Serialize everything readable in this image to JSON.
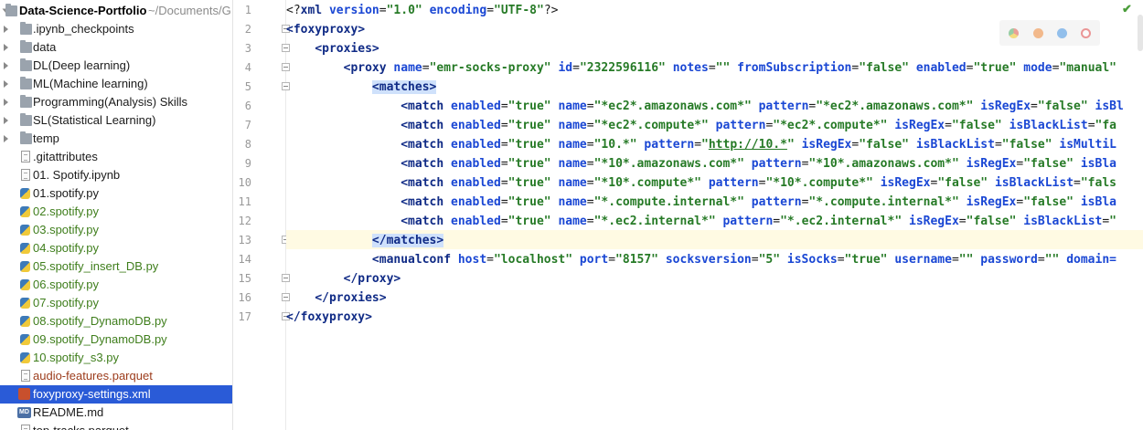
{
  "project_tree": {
    "root": {
      "name": "Data-Science-Portfolio",
      "path": "~/Documents/G"
    },
    "items": [
      {
        "label": ".ipynb_checkpoints",
        "kind": "folder",
        "color": "default"
      },
      {
        "label": "data",
        "kind": "folder",
        "color": "default"
      },
      {
        "label": "DL(Deep learning)",
        "kind": "folder",
        "color": "default"
      },
      {
        "label": "ML(Machine learning)",
        "kind": "folder",
        "color": "default"
      },
      {
        "label": "Programming(Analysis) Skills",
        "kind": "folder",
        "color": "default"
      },
      {
        "label": "SL(Statistical Learning)",
        "kind": "folder",
        "color": "default"
      },
      {
        "label": "temp",
        "kind": "folder",
        "color": "default"
      },
      {
        "label": ".gitattributes",
        "kind": "text-file",
        "color": "default"
      },
      {
        "label": "01. Spotify.ipynb",
        "kind": "text-file",
        "color": "default"
      },
      {
        "label": "01.spotify.py",
        "kind": "python-file",
        "color": "default"
      },
      {
        "label": "02.spotify.py",
        "kind": "python-file",
        "color": "green"
      },
      {
        "label": "03.spotify.py",
        "kind": "python-file",
        "color": "green"
      },
      {
        "label": "04.spotify.py",
        "kind": "python-file",
        "color": "green"
      },
      {
        "label": "05.spotify_insert_DB.py",
        "kind": "python-file",
        "color": "green"
      },
      {
        "label": "06.spotify.py",
        "kind": "python-file",
        "color": "green"
      },
      {
        "label": "07.spotify.py",
        "kind": "python-file",
        "color": "green"
      },
      {
        "label": "08.spotify_DynamoDB.py",
        "kind": "python-file",
        "color": "green"
      },
      {
        "label": "09.spotify_DynamoDB.py",
        "kind": "python-file",
        "color": "green"
      },
      {
        "label": "10.spotify_s3.py",
        "kind": "python-file",
        "color": "green"
      },
      {
        "label": "audio-features.parquet",
        "kind": "text-file",
        "color": "brown"
      },
      {
        "label": "foxyproxy-settings.xml",
        "kind": "xml-file",
        "color": "default",
        "selected": true
      },
      {
        "label": "README.md",
        "kind": "md-file",
        "color": "default"
      },
      {
        "label": "top-tracks.parquet",
        "kind": "text-file",
        "color": "default"
      }
    ]
  },
  "editor": {
    "line_numbers": [
      "1",
      "2",
      "3",
      "4",
      "5",
      "6",
      "7",
      "8",
      "9",
      "10",
      "11",
      "12",
      "13",
      "14",
      "15",
      "16",
      "17"
    ],
    "lines": [
      [
        {
          "t": "pi",
          "v": "<?"
        },
        {
          "t": "tag",
          "v": "xml "
        },
        {
          "t": "attr",
          "v": "version"
        },
        {
          "t": "plain",
          "v": "="
        },
        {
          "t": "val",
          "v": "\"1.0\" "
        },
        {
          "t": "attr",
          "v": "encoding"
        },
        {
          "t": "plain",
          "v": "="
        },
        {
          "t": "val",
          "v": "\"UTF-8\""
        },
        {
          "t": "pi",
          "v": "?>"
        }
      ],
      [
        {
          "t": "tag",
          "v": "<foxyproxy>"
        }
      ],
      [
        {
          "t": "plain",
          "v": "    "
        },
        {
          "t": "tag",
          "v": "<proxies>"
        }
      ],
      [
        {
          "t": "plain",
          "v": "        "
        },
        {
          "t": "tag",
          "v": "<proxy "
        },
        {
          "t": "attr",
          "v": "name"
        },
        {
          "t": "plain",
          "v": "="
        },
        {
          "t": "val",
          "v": "\"emr-socks-proxy\" "
        },
        {
          "t": "attr",
          "v": "id"
        },
        {
          "t": "plain",
          "v": "="
        },
        {
          "t": "val",
          "v": "\"2322596116\" "
        },
        {
          "t": "attr",
          "v": "notes"
        },
        {
          "t": "plain",
          "v": "="
        },
        {
          "t": "val",
          "v": "\"\" "
        },
        {
          "t": "attr",
          "v": "fromSubscription"
        },
        {
          "t": "plain",
          "v": "="
        },
        {
          "t": "val",
          "v": "\"false\" "
        },
        {
          "t": "attr",
          "v": "enabled"
        },
        {
          "t": "plain",
          "v": "="
        },
        {
          "t": "val",
          "v": "\"true\" "
        },
        {
          "t": "attr",
          "v": "mode"
        },
        {
          "t": "plain",
          "v": "="
        },
        {
          "t": "val",
          "v": "\"manual\""
        }
      ],
      [
        {
          "t": "plain",
          "v": "            "
        },
        {
          "t": "taghl",
          "v": "<matches>"
        }
      ],
      [
        {
          "t": "plain",
          "v": "                "
        },
        {
          "t": "tag",
          "v": "<match "
        },
        {
          "t": "attr",
          "v": "enabled"
        },
        {
          "t": "plain",
          "v": "="
        },
        {
          "t": "val",
          "v": "\"true\" "
        },
        {
          "t": "attr",
          "v": "name"
        },
        {
          "t": "plain",
          "v": "="
        },
        {
          "t": "val",
          "v": "\"*ec2*.amazonaws.com*\" "
        },
        {
          "t": "attr",
          "v": "pattern"
        },
        {
          "t": "plain",
          "v": "="
        },
        {
          "t": "val",
          "v": "\"*ec2*.amazonaws.com*\" "
        },
        {
          "t": "attr",
          "v": "isRegEx"
        },
        {
          "t": "plain",
          "v": "="
        },
        {
          "t": "val",
          "v": "\"false\" "
        },
        {
          "t": "attr",
          "v": "isBl"
        }
      ],
      [
        {
          "t": "plain",
          "v": "                "
        },
        {
          "t": "tag",
          "v": "<match "
        },
        {
          "t": "attr",
          "v": "enabled"
        },
        {
          "t": "plain",
          "v": "="
        },
        {
          "t": "val",
          "v": "\"true\" "
        },
        {
          "t": "attr",
          "v": "name"
        },
        {
          "t": "plain",
          "v": "="
        },
        {
          "t": "val",
          "v": "\"*ec2*.compute*\" "
        },
        {
          "t": "attr",
          "v": "pattern"
        },
        {
          "t": "plain",
          "v": "="
        },
        {
          "t": "val",
          "v": "\"*ec2*.compute*\" "
        },
        {
          "t": "attr",
          "v": "isRegEx"
        },
        {
          "t": "plain",
          "v": "="
        },
        {
          "t": "val",
          "v": "\"false\" "
        },
        {
          "t": "attr",
          "v": "isBlackList"
        },
        {
          "t": "plain",
          "v": "="
        },
        {
          "t": "val",
          "v": "\"fa"
        }
      ],
      [
        {
          "t": "plain",
          "v": "                "
        },
        {
          "t": "tag",
          "v": "<match "
        },
        {
          "t": "attr",
          "v": "enabled"
        },
        {
          "t": "plain",
          "v": "="
        },
        {
          "t": "val",
          "v": "\"true\" "
        },
        {
          "t": "attr",
          "v": "name"
        },
        {
          "t": "plain",
          "v": "="
        },
        {
          "t": "val",
          "v": "\"10.*\" "
        },
        {
          "t": "attr",
          "v": "pattern"
        },
        {
          "t": "plain",
          "v": "="
        },
        {
          "t": "val",
          "v": "\""
        },
        {
          "t": "url",
          "v": "http://10.*"
        },
        {
          "t": "val",
          "v": "\" "
        },
        {
          "t": "attr",
          "v": "isRegEx"
        },
        {
          "t": "plain",
          "v": "="
        },
        {
          "t": "val",
          "v": "\"false\" "
        },
        {
          "t": "attr",
          "v": "isBlackList"
        },
        {
          "t": "plain",
          "v": "="
        },
        {
          "t": "val",
          "v": "\"false\" "
        },
        {
          "t": "attr",
          "v": "isMultiL"
        }
      ],
      [
        {
          "t": "plain",
          "v": "                "
        },
        {
          "t": "tag",
          "v": "<match "
        },
        {
          "t": "attr",
          "v": "enabled"
        },
        {
          "t": "plain",
          "v": "="
        },
        {
          "t": "val",
          "v": "\"true\" "
        },
        {
          "t": "attr",
          "v": "name"
        },
        {
          "t": "plain",
          "v": "="
        },
        {
          "t": "val",
          "v": "\"*10*.amazonaws.com*\" "
        },
        {
          "t": "attr",
          "v": "pattern"
        },
        {
          "t": "plain",
          "v": "="
        },
        {
          "t": "val",
          "v": "\"*10*.amazonaws.com*\" "
        },
        {
          "t": "attr",
          "v": "isRegEx"
        },
        {
          "t": "plain",
          "v": "="
        },
        {
          "t": "val",
          "v": "\"false\" "
        },
        {
          "t": "attr",
          "v": "isBla"
        }
      ],
      [
        {
          "t": "plain",
          "v": "                "
        },
        {
          "t": "tag",
          "v": "<match "
        },
        {
          "t": "attr",
          "v": "enabled"
        },
        {
          "t": "plain",
          "v": "="
        },
        {
          "t": "val",
          "v": "\"true\" "
        },
        {
          "t": "attr",
          "v": "name"
        },
        {
          "t": "plain",
          "v": "="
        },
        {
          "t": "val",
          "v": "\"*10*.compute*\" "
        },
        {
          "t": "attr",
          "v": "pattern"
        },
        {
          "t": "plain",
          "v": "="
        },
        {
          "t": "val",
          "v": "\"*10*.compute*\" "
        },
        {
          "t": "attr",
          "v": "isRegEx"
        },
        {
          "t": "plain",
          "v": "="
        },
        {
          "t": "val",
          "v": "\"false\" "
        },
        {
          "t": "attr",
          "v": "isBlackList"
        },
        {
          "t": "plain",
          "v": "="
        },
        {
          "t": "val",
          "v": "\"fals"
        }
      ],
      [
        {
          "t": "plain",
          "v": "                "
        },
        {
          "t": "tag",
          "v": "<match "
        },
        {
          "t": "attr",
          "v": "enabled"
        },
        {
          "t": "plain",
          "v": "="
        },
        {
          "t": "val",
          "v": "\"true\" "
        },
        {
          "t": "attr",
          "v": "name"
        },
        {
          "t": "plain",
          "v": "="
        },
        {
          "t": "val",
          "v": "\"*.compute.internal*\" "
        },
        {
          "t": "attr",
          "v": "pattern"
        },
        {
          "t": "plain",
          "v": "="
        },
        {
          "t": "val",
          "v": "\"*.compute.internal*\" "
        },
        {
          "t": "attr",
          "v": "isRegEx"
        },
        {
          "t": "plain",
          "v": "="
        },
        {
          "t": "val",
          "v": "\"false\" "
        },
        {
          "t": "attr",
          "v": "isBla"
        }
      ],
      [
        {
          "t": "plain",
          "v": "                "
        },
        {
          "t": "tag",
          "v": "<match "
        },
        {
          "t": "attr",
          "v": "enabled"
        },
        {
          "t": "plain",
          "v": "="
        },
        {
          "t": "val",
          "v": "\"true\" "
        },
        {
          "t": "attr",
          "v": "name"
        },
        {
          "t": "plain",
          "v": "="
        },
        {
          "t": "val",
          "v": "\"*.ec2.internal*\" "
        },
        {
          "t": "attr",
          "v": "pattern"
        },
        {
          "t": "plain",
          "v": "="
        },
        {
          "t": "val",
          "v": "\"*.ec2.internal*\" "
        },
        {
          "t": "attr",
          "v": "isRegEx"
        },
        {
          "t": "plain",
          "v": "="
        },
        {
          "t": "val",
          "v": "\"false\" "
        },
        {
          "t": "attr",
          "v": "isBlackList"
        },
        {
          "t": "plain",
          "v": "="
        },
        {
          "t": "val",
          "v": "\""
        }
      ],
      [
        {
          "t": "plain",
          "v": "            "
        },
        {
          "t": "taghl",
          "v": "</matches>"
        }
      ],
      [
        {
          "t": "plain",
          "v": "            "
        },
        {
          "t": "tag",
          "v": "<manualconf "
        },
        {
          "t": "attr",
          "v": "host"
        },
        {
          "t": "plain",
          "v": "="
        },
        {
          "t": "val",
          "v": "\"localhost\" "
        },
        {
          "t": "attr",
          "v": "port"
        },
        {
          "t": "plain",
          "v": "="
        },
        {
          "t": "val",
          "v": "\"8157\" "
        },
        {
          "t": "attr",
          "v": "socksversion"
        },
        {
          "t": "plain",
          "v": "="
        },
        {
          "t": "val",
          "v": "\"5\" "
        },
        {
          "t": "attr",
          "v": "isSocks"
        },
        {
          "t": "plain",
          "v": "="
        },
        {
          "t": "val",
          "v": "\"true\" "
        },
        {
          "t": "attr",
          "v": "username"
        },
        {
          "t": "plain",
          "v": "="
        },
        {
          "t": "val",
          "v": "\"\" "
        },
        {
          "t": "attr",
          "v": "password"
        },
        {
          "t": "plain",
          "v": "="
        },
        {
          "t": "val",
          "v": "\"\" "
        },
        {
          "t": "attr",
          "v": "domain="
        }
      ],
      [
        {
          "t": "plain",
          "v": "        "
        },
        {
          "t": "tag",
          "v": "</proxy>"
        }
      ],
      [
        {
          "t": "plain",
          "v": "    "
        },
        {
          "t": "tag",
          "v": "</proxies>"
        }
      ],
      [
        {
          "t": "tag",
          "v": "</foxyproxy>"
        }
      ]
    ],
    "browser_icons": [
      "chrome-icon",
      "firefox-icon",
      "safari-icon",
      "opera-icon"
    ],
    "inspection_status": "check-icon"
  },
  "colors": {
    "selection": "#2a5bd7",
    "tag": "#102b86",
    "attribute": "#1a47d4",
    "value": "#267a26",
    "vcs_added": "#3f7e1c",
    "vcs_unversioned": "#9c3c1c",
    "current_line": "#fffae3",
    "tag_highlight": "#cfe1fb"
  }
}
